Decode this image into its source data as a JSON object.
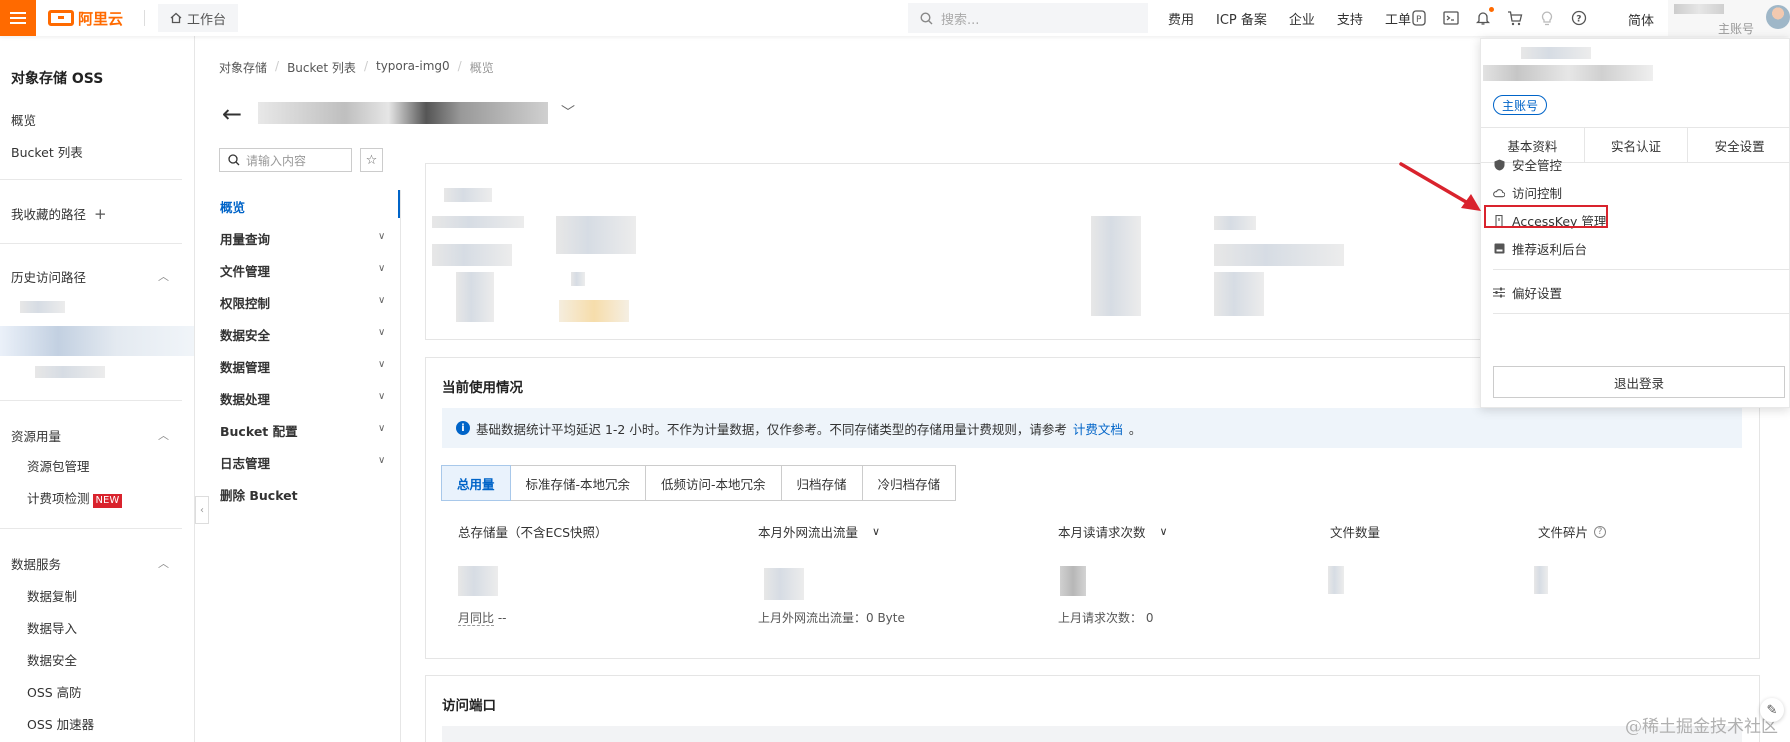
{
  "topbar": {
    "logo_text": "阿里云",
    "workbench_label": "工作台",
    "search_placeholder": "搜索...",
    "links": [
      "费用",
      "ICP 备案",
      "企业",
      "支持",
      "工单"
    ],
    "language": "简体",
    "account_sub": "主账号"
  },
  "leftnav": {
    "title": "对象存储 OSS",
    "items": [
      "概览",
      "Bucket 列表"
    ],
    "favorites": "我收藏的路径",
    "history": "历史访问路径",
    "resource_section": "资源用量",
    "resource_items": [
      "资源包管理",
      "计费项检测"
    ],
    "new_badge": "NEW",
    "data_section": "数据服务",
    "data_items": [
      "数据复制",
      "数据导入",
      "数据安全",
      "OSS 高防",
      "OSS 加速器"
    ]
  },
  "breadcrumb": [
    "对象存储",
    "Bucket 列表",
    "typora-img0",
    "概览"
  ],
  "bucket_menu": {
    "search_placeholder": "请输入内容",
    "items": [
      "概览",
      "用量查询",
      "文件管理",
      "权限控制",
      "数据安全",
      "数据管理",
      "数据处理",
      "Bucket 配置",
      "日志管理",
      "删除 Bucket"
    ]
  },
  "usage": {
    "title": "当前使用情况",
    "notice": "基础数据统计平均延迟 1-2 小时。不作为计量数据，仅作参考。不同存储类型的存储用量计费规则，请参考",
    "notice_link": "计费文档",
    "notice_end": "。",
    "tabs": [
      "总用量",
      "标准存储-本地冗余",
      "低频访问-本地冗余",
      "归档存储",
      "冷归档存储"
    ],
    "metrics": {
      "storage": "总存储量（不含ECS快照）",
      "traffic": "本月外网流出流量",
      "requests": "本月读请求次数",
      "files": "文件数量",
      "fragments": "文件碎片"
    },
    "mom_label": "月同比",
    "mom_value": "--",
    "last_traffic": "上月外网流出流量：0 Byte",
    "last_requests": "上月请求次数：",
    "last_requests_value": "0"
  },
  "endpoint": {
    "title": "访问端口"
  },
  "dropdown": {
    "tag": "主账号",
    "tabs": [
      "基本资料",
      "实名认证",
      "安全设置"
    ],
    "items": [
      "安全管控",
      "访问控制",
      "AccessKey 管理",
      "推荐返利后台"
    ],
    "prefs": "偏好设置",
    "logout": "退出登录"
  },
  "watermark": "@稀土掘金技术社区",
  "colors": {
    "brand": "#ff6a00",
    "link": "#0064c8",
    "highlight": "#d9232d"
  }
}
